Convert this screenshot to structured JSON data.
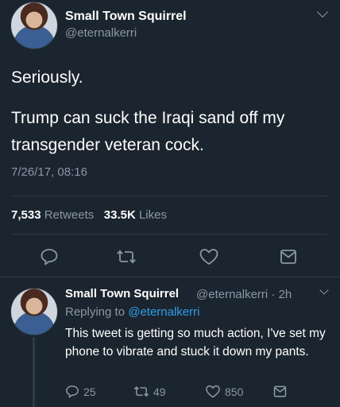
{
  "tweet": {
    "display_name": "Small Town Squirrel",
    "handle": "@eternalkerri",
    "line1": "Seriously.",
    "line2": "Trump can suck the Iraqi sand off my transgender veteran cock.",
    "timestamp": "7/26/17, 08:16",
    "retweets_count": "7,533",
    "retweets_label": "Retweets",
    "likes_count": "33.5K",
    "likes_label": "Likes",
    "icons": [
      "reply-icon",
      "retweet-icon",
      "like-icon",
      "share-icon"
    ]
  },
  "reply": {
    "display_name": "Small Town Squirrel",
    "handle_time": "@eternalkerri · 2h",
    "replying_prefix": "Replying to",
    "replying_handle": "@eternalkerri",
    "text": "This tweet is getting so much action, I've set my phone to vibrate and stuck it down my pants.",
    "reply_count": "25",
    "retweet_count": "49",
    "like_count": "850"
  },
  "colors": {
    "background": "#1b2530",
    "muted": "#8a97a6",
    "accent": "#2f9fe8"
  }
}
